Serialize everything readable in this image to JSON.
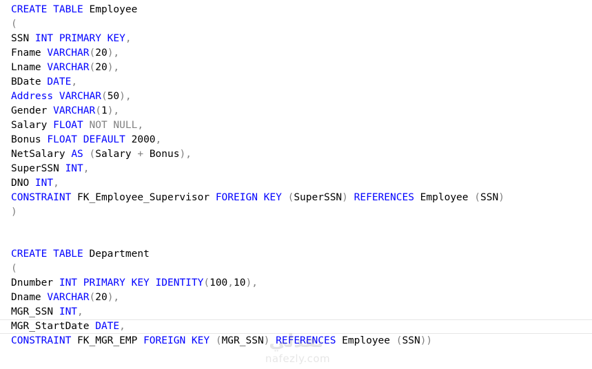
{
  "editor": {
    "lines": [
      [
        {
          "t": "CREATE TABLE",
          "c": "kw"
        },
        {
          "t": " Employee",
          "c": "plain"
        }
      ],
      [
        {
          "t": "(",
          "c": "punc"
        }
      ],
      [
        {
          "t": "SSN ",
          "c": "plain"
        },
        {
          "t": "INT PRIMARY KEY",
          "c": "kw"
        },
        {
          "t": ",",
          "c": "punc"
        }
      ],
      [
        {
          "t": "Fname ",
          "c": "plain"
        },
        {
          "t": "VARCHAR",
          "c": "kw"
        },
        {
          "t": "(",
          "c": "punc"
        },
        {
          "t": "20",
          "c": "num"
        },
        {
          "t": "),",
          "c": "punc"
        }
      ],
      [
        {
          "t": "Lname ",
          "c": "plain"
        },
        {
          "t": "VARCHAR",
          "c": "kw"
        },
        {
          "t": "(",
          "c": "punc"
        },
        {
          "t": "20",
          "c": "num"
        },
        {
          "t": "),",
          "c": "punc"
        }
      ],
      [
        {
          "t": "BDate ",
          "c": "plain"
        },
        {
          "t": "DATE",
          "c": "kw"
        },
        {
          "t": ",",
          "c": "punc"
        }
      ],
      [
        {
          "t": "Address ",
          "c": "kw"
        },
        {
          "t": "VARCHAR",
          "c": "kw"
        },
        {
          "t": "(",
          "c": "punc"
        },
        {
          "t": "50",
          "c": "num"
        },
        {
          "t": "),",
          "c": "punc"
        }
      ],
      [
        {
          "t": "Gender ",
          "c": "plain"
        },
        {
          "t": "VARCHAR",
          "c": "kw"
        },
        {
          "t": "(",
          "c": "punc"
        },
        {
          "t": "1",
          "c": "num"
        },
        {
          "t": "),",
          "c": "punc"
        }
      ],
      [
        {
          "t": "Salary ",
          "c": "plain"
        },
        {
          "t": "FLOAT ",
          "c": "kw"
        },
        {
          "t": "NOT NULL",
          "c": "gray"
        },
        {
          "t": ",",
          "c": "punc"
        }
      ],
      [
        {
          "t": "Bonus ",
          "c": "plain"
        },
        {
          "t": "FLOAT DEFAULT ",
          "c": "kw"
        },
        {
          "t": "2000",
          "c": "num"
        },
        {
          "t": ",",
          "c": "punc"
        }
      ],
      [
        {
          "t": "NetSalary ",
          "c": "plain"
        },
        {
          "t": "AS ",
          "c": "kw"
        },
        {
          "t": "(",
          "c": "punc"
        },
        {
          "t": "Salary ",
          "c": "plain"
        },
        {
          "t": "+ ",
          "c": "punc"
        },
        {
          "t": "Bonus",
          "c": "plain"
        },
        {
          "t": "),",
          "c": "punc"
        }
      ],
      [
        {
          "t": "SuperSSN ",
          "c": "plain"
        },
        {
          "t": "INT",
          "c": "kw"
        },
        {
          "t": ",",
          "c": "punc"
        }
      ],
      [
        {
          "t": "DNO ",
          "c": "plain"
        },
        {
          "t": "INT",
          "c": "kw"
        },
        {
          "t": ",",
          "c": "punc"
        }
      ],
      [
        {
          "t": "CONSTRAINT ",
          "c": "kw"
        },
        {
          "t": "FK_Employee_Supervisor ",
          "c": "plain"
        },
        {
          "t": "FOREIGN KEY ",
          "c": "kw"
        },
        {
          "t": "(",
          "c": "punc"
        },
        {
          "t": "SuperSSN",
          "c": "plain"
        },
        {
          "t": ") ",
          "c": "punc"
        },
        {
          "t": "REFERENCES ",
          "c": "kw"
        },
        {
          "t": "Employee ",
          "c": "plain"
        },
        {
          "t": "(",
          "c": "punc"
        },
        {
          "t": "SSN",
          "c": "plain"
        },
        {
          "t": ")",
          "c": "punc"
        }
      ],
      [
        {
          "t": ")",
          "c": "punc"
        }
      ],
      [],
      [],
      [
        {
          "t": "CREATE TABLE",
          "c": "kw"
        },
        {
          "t": " Department",
          "c": "plain"
        }
      ],
      [
        {
          "t": "(",
          "c": "punc"
        }
      ],
      [
        {
          "t": "Dnumber ",
          "c": "plain"
        },
        {
          "t": "INT PRIMARY KEY IDENTITY",
          "c": "kw"
        },
        {
          "t": "(",
          "c": "punc"
        },
        {
          "t": "100",
          "c": "num"
        },
        {
          "t": ",",
          "c": "punc"
        },
        {
          "t": "10",
          "c": "num"
        },
        {
          "t": "),",
          "c": "punc"
        }
      ],
      [
        {
          "t": "Dname ",
          "c": "plain"
        },
        {
          "t": "VARCHAR",
          "c": "kw"
        },
        {
          "t": "(",
          "c": "punc"
        },
        {
          "t": "20",
          "c": "num"
        },
        {
          "t": "),",
          "c": "punc"
        }
      ],
      [
        {
          "t": "MGR_SSN ",
          "c": "plain"
        },
        {
          "t": "INT",
          "c": "kw"
        },
        {
          "t": ",",
          "c": "punc"
        }
      ],
      [
        {
          "t": "MGR_StartDate ",
          "c": "plain"
        },
        {
          "t": "DATE",
          "c": "kw"
        },
        {
          "t": ",",
          "c": "punc"
        }
      ],
      [
        {
          "t": "CONSTRAINT ",
          "c": "kw"
        },
        {
          "t": "FK_MGR_EMP ",
          "c": "plain"
        },
        {
          "t": "FOREIGN KEY ",
          "c": "kw"
        },
        {
          "t": "(",
          "c": "punc"
        },
        {
          "t": "MGR_SSN",
          "c": "plain"
        },
        {
          "t": ") ",
          "c": "punc"
        },
        {
          "t": "REFERENCES ",
          "c": "kw"
        },
        {
          "t": "Employee ",
          "c": "plain"
        },
        {
          "t": "(",
          "c": "punc"
        },
        {
          "t": "SSN",
          "c": "plain"
        },
        {
          "t": "))",
          "c": "punc"
        }
      ]
    ]
  },
  "watermark": {
    "text": "nafezly.com",
    "logo": "نفذلي"
  },
  "colors": {
    "keyword": "#0000ff",
    "punctuation": "#808080",
    "text": "#000000",
    "background": "#ffffff"
  }
}
